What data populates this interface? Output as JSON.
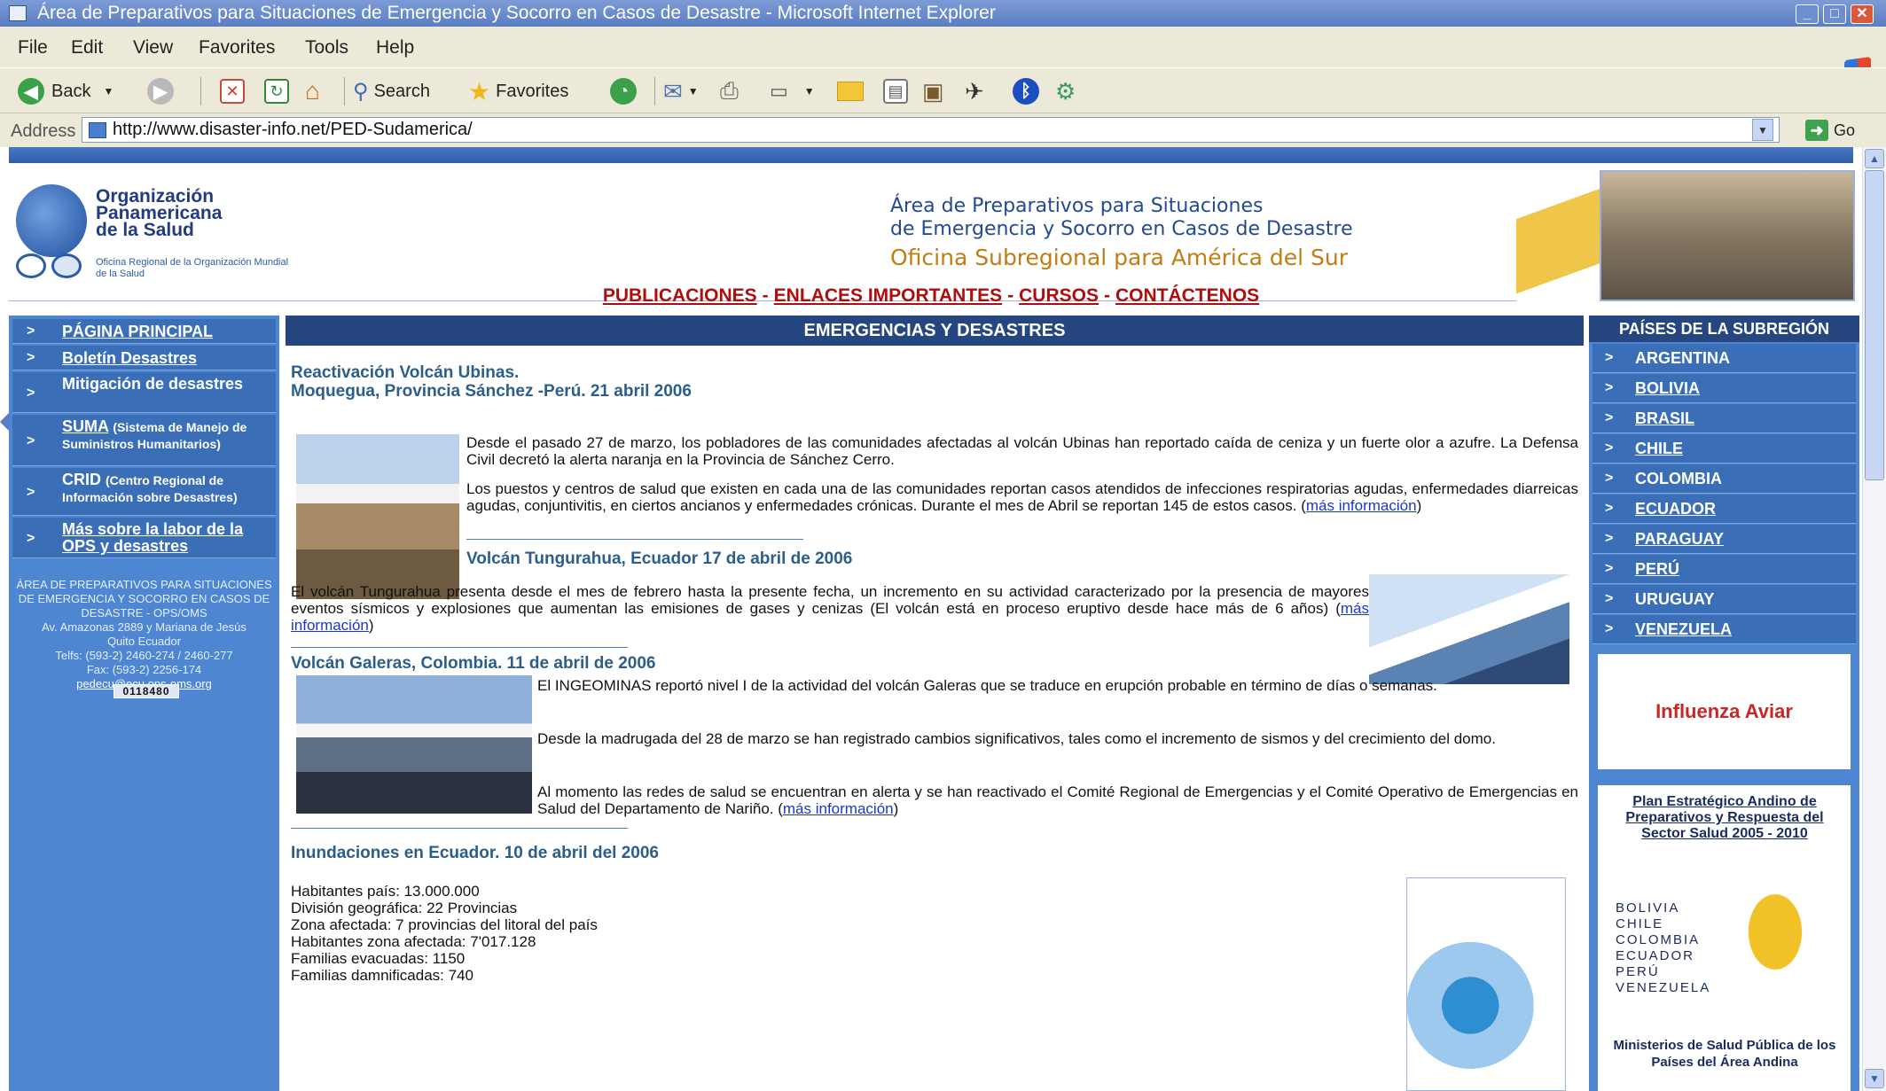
{
  "window": {
    "title": "Área de Preparativos para Situaciones de Emergencia y Socorro en Casos de Desastre - Microsoft Internet Explorer",
    "min_glyph": "_",
    "max_glyph": "□",
    "close_glyph": "✕"
  },
  "menu": {
    "file": "File",
    "edit": "Edit",
    "view": "View",
    "favorites": "Favorites",
    "tools": "Tools",
    "help": "Help"
  },
  "toolbar": {
    "back_label": "Back",
    "search_label": "Search",
    "favorites_label": "Favorites"
  },
  "address": {
    "label": "Address",
    "url": "http://www.disaster-info.net/PED-Sudamerica/",
    "go_label": "Go"
  },
  "header": {
    "org_name_line1": "Organización",
    "org_name_line2": "Panamericana",
    "org_name_line3": "de la Salud",
    "org_sub": "Oficina Regional de la Organización Mundial de la Salud",
    "title_line1": "Área de Preparativos para Situaciones",
    "title_line2": "de Emergencia y Socorro en Casos de Desastre",
    "title_line3": "Oficina Subregional para América del Sur"
  },
  "topnav": {
    "publicaciones": "PUBLICACIONES",
    "enlaces": "ENLACES IMPORTANTES",
    "cursos": "CURSOS",
    "contactenos": "CONTÁCTENOS",
    "separator": "-"
  },
  "left_nav": {
    "chevron": ">",
    "pagina_principal": "PÁGINA PRINCIPAL",
    "boletin": "Boletín Desastres",
    "mitigacion": "Mitigación de desastres",
    "suma": "SUMA",
    "suma_desc": "(Sistema de Manejo de Suministros Humanitarios)",
    "crid": "CRID",
    "crid_desc": "(Centro Regional de Información sobre Desastres)",
    "mas_labor": "Más sobre la labor de la OPS y desastres",
    "address_lines": "ÁREA DE PREPARATIVOS PARA SITUACIONES DE EMERGENCIA Y SOCORRO EN CASOS DE DESASTRE - OPS/OMS",
    "address_street": "Av. Amazonas 2889 y Mariana de Jesús",
    "address_city": "Quito Ecuador",
    "address_phone": "Telfs: (593-2) 2460-274 / 2460-277",
    "address_fax": "Fax: (593-2) 2256-174",
    "address_email": "pedecu@ecu.ops-oms.org",
    "counter": "0118480"
  },
  "main": {
    "header": "EMERGENCIAS Y DESASTRES",
    "more_info": "más información",
    "news1_title_line1": "Reactivación Volcán Ubinas.",
    "news1_title_line2": "Moquegua, Provincia Sánchez -Perú. 21 abril 2006",
    "news1_p1": "Desde el pasado 27 de marzo, los pobladores de las comunidades afectadas al volcán Ubinas han reportado caída de ceniza y un fuerte olor a azufre. La Defensa Civil decretó la alerta naranja en la Provincia de Sánchez Cerro.",
    "news1_p2": "Los puestos y centros de salud que existen en cada una de las comunidades reportan casos atendidos de infecciones respiratorias agudas, enfermedades diarreicas agudas, conjuntivitis, en ciertos ancianos y enfermedades crónicas. Durante el mes de Abril se reportan 145 de estos casos.",
    "news2_title": "Volcán Tungurahua, Ecuador 17 de abril de 2006",
    "news2_body": "El volcán Tungurahua presenta desde el mes de febrero hasta la presente fecha, un incremento en su actividad caracterizado por la presencia de mayores eventos sísmicos y explosiones que aumentan las emisiones de gases y cenizas (El volcán está en proceso eruptivo desde hace más de 6 años)",
    "news3_title": "Volcán Galeras, Colombia. 11 de abril de 2006",
    "news3_p1": "El INGEOMINAS reportó nivel I de la actividad del volcán Galeras que se traduce en erupción probable en término de días o semanas.",
    "news3_p2": "Desde la madrugada del 28 de marzo se han registrado cambios significativos, tales como el incremento de sismos y del crecimiento del domo.",
    "news3_p3": "Al momento las redes de salud se encuentran en alerta y se han reactivado el Comité Regional de Emergencias y el Comité Operativo de Emergencias en Salud del Departamento de Nariño.",
    "news4_title": "Inundaciones en Ecuador. 10 de abril del 2006",
    "news4_line1": "Habitantes país: 13.000.000",
    "news4_line2": "División geográfica: 22 Provincias",
    "news4_line3": "Zona afectada: 7 provincias del litoral del país",
    "news4_line4": "Habitantes zona afectada: 7'017.128",
    "news4_line5": "Familias evacuadas: 1150",
    "news4_line6": "Familias damnificadas: 740"
  },
  "right": {
    "header": "PAÍSES DE LA SUBREGIÓN",
    "chevron": ">",
    "countries": [
      "ARGENTINA",
      "BOLIVIA",
      "BRASIL",
      "CHILE",
      "COLOMBIA",
      "ECUADOR",
      "PARAGUAY",
      "PERÚ",
      "URUGUAY",
      "VENEZUELA"
    ],
    "influenza": "Influenza Aviar",
    "plan_title": "Plan Estratégico Andino de Preparativos y Respuesta del Sector Salud 2005 - 2010",
    "plan_countries": [
      "BOLIVIA",
      "CHILE",
      "COLOMBIA",
      "ECUADOR",
      "PERÚ",
      "VENEZUELA"
    ],
    "plan_footer": "Ministerios de Salud Pública de los Países del Área Andina"
  },
  "colors": {
    "sidebar_blue": "#4f86d1",
    "header_navy": "#25467f",
    "nav_red": "#b00c0c",
    "news_title": "#2b5e8a",
    "link_blue": "#1a37c9"
  }
}
